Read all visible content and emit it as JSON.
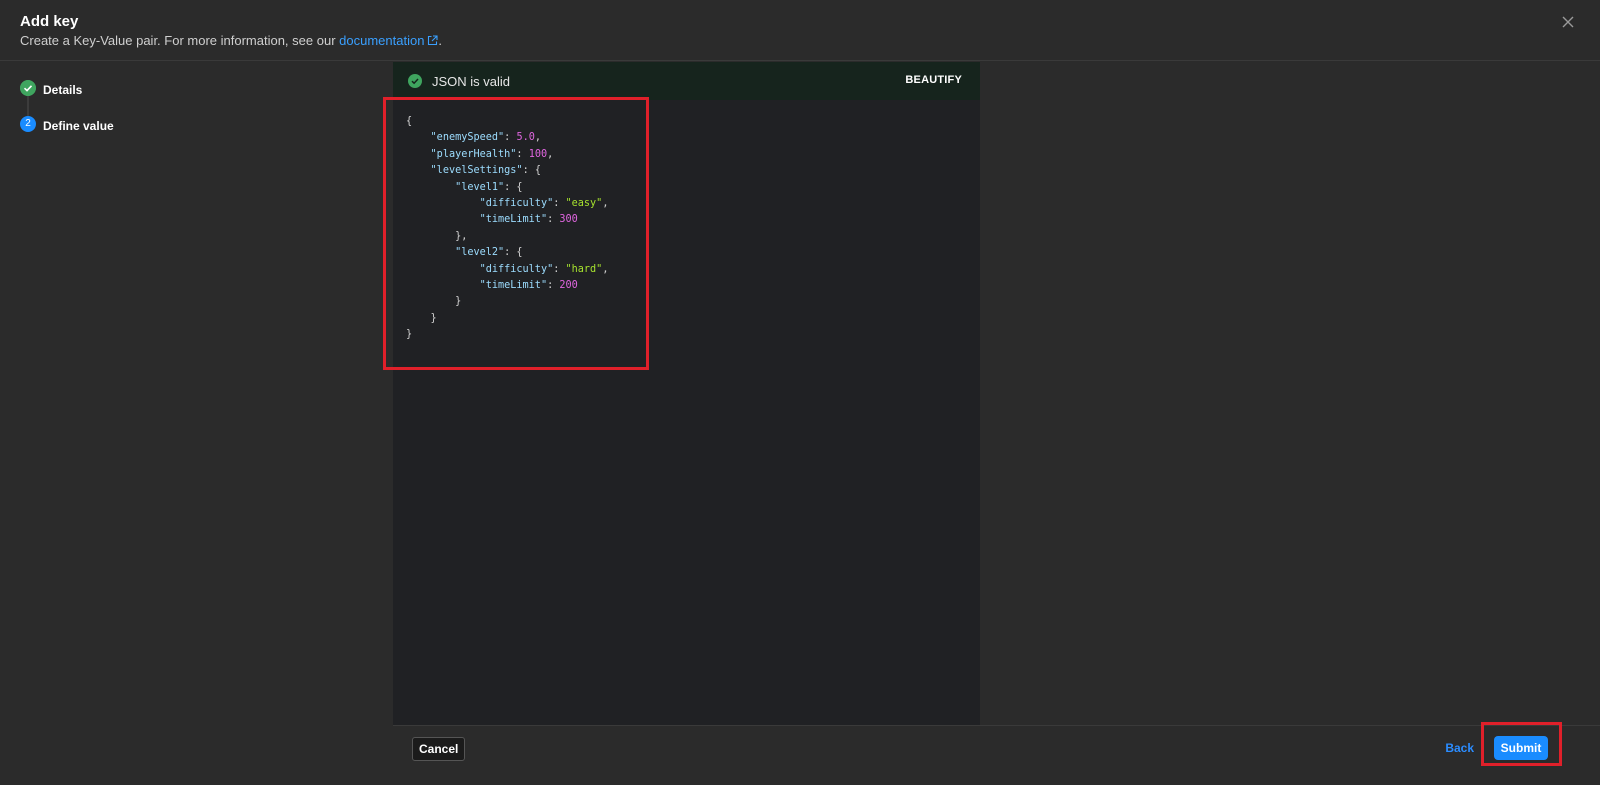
{
  "dialog": {
    "title": "Add key",
    "subtitle_prefix": "Create a Key-Value pair. For more information, see our ",
    "doc_link": "documentation",
    "subtitle_suffix": ".",
    "close_icon": "close-icon"
  },
  "steps": [
    {
      "label": "Details",
      "status": "complete",
      "icon": "check-circle-icon"
    },
    {
      "label": "Define value",
      "status": "active",
      "number": "2"
    }
  ],
  "editor": {
    "validation_text": "JSON is valid",
    "validation_icon": "check-circle-icon",
    "beautify_label": "BEAUTIFY",
    "content": "{\n    \"enemySpeed\": 5.0,\n    \"playerHealth\": 100,\n    \"levelSettings\": {\n        \"level1\": {\n            \"difficulty\": \"easy\",\n            \"timeLimit\": 300\n        },\n        \"level2\": {\n            \"difficulty\": \"hard\",\n            \"timeLimit\": 200\n        }\n    }\n}"
  },
  "footer": {
    "cancel_label": "Cancel",
    "back_label": "Back",
    "submit_label": "Submit"
  },
  "colors": {
    "accent": "#1a8cff",
    "valid": "#3fa55f",
    "highlight": "#e0202a"
  }
}
